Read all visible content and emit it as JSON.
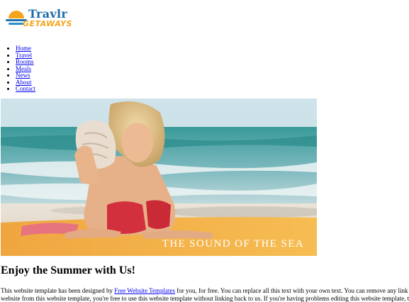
{
  "logo": {
    "title": "Travlr",
    "tagline": "GETAWAYS"
  },
  "nav": [
    {
      "label": "Home"
    },
    {
      "label": "Travel"
    },
    {
      "label": "Rooms"
    },
    {
      "label": "Meals"
    },
    {
      "label": "News"
    },
    {
      "label": "About"
    },
    {
      "label": "Contact"
    }
  ],
  "hero": {
    "caption": "THE SOUND OF THE SEA"
  },
  "main": {
    "heading": "Enjoy the Summer with Us!",
    "paragraph_1_start": "This website template has been designed by ",
    "paragraph_1_link": "Free Website Templates",
    "paragraph_1_end": " for you, for free. You can replace all this text with your own text. You can remove any link to our",
    "paragraph_2": "website from this website template, you're free to use this website template without linking back to us. If you're having problems editing this website template, then don't"
  },
  "colors": {
    "link": "#0000ee",
    "logo_blue": "#1d6aa8",
    "logo_orange": "#f3a51d"
  }
}
